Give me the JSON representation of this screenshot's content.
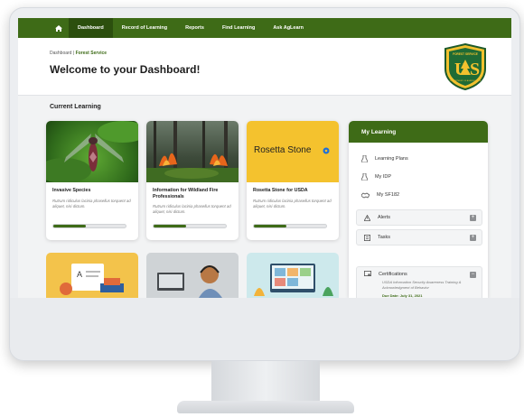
{
  "nav": {
    "home_icon": "home-icon",
    "items": [
      {
        "label": "Dashboard",
        "active": true
      },
      {
        "label": "Record of Learning"
      },
      {
        "label": "Reports"
      },
      {
        "label": "Find Learning"
      },
      {
        "label": "Ask AgLearn"
      }
    ]
  },
  "header": {
    "breadcrumb_root": "Dashboard",
    "breadcrumb_sep": "|",
    "breadcrumb_current": "Forest Service",
    "title": "Welcome to your Dashboard!"
  },
  "logo": {
    "top_text": "FOREST SERVICE",
    "letters": "US",
    "bottom_text": "DEPARTMENT OF AGRICULTURE"
  },
  "current_learning": {
    "title": "Current Learning",
    "cards": [
      {
        "title": "Invasive Species",
        "desc": "Rutrum ridiculus lacinia phasellus torquent ad aliquet, nisi dictum.",
        "progress": 0.45
      },
      {
        "title": "Information for Wildland Fire Professionals",
        "desc": "Rutrum ridiculus lacinia phasellus torquent ad aliquet, nisi dictum.",
        "progress": 0.45
      },
      {
        "title": "Rosetta Stone for USDA",
        "desc": "Rutrum ridiculus lacinia phasellus torquent ad aliquet, nisi dictum.",
        "progress": 0.45,
        "brand": "Rosetta Stone"
      }
    ]
  },
  "my_learning": {
    "title": "My Learning",
    "links": [
      {
        "label": "Learning Plans",
        "icon": "flask-icon"
      },
      {
        "label": "My IDP",
        "icon": "flask-icon"
      },
      {
        "label": "My SF182",
        "icon": "handshake-icon"
      }
    ],
    "accordions": [
      {
        "label": "Alerts",
        "icon": "warning-icon",
        "toggle": "+"
      },
      {
        "label": "Tasks",
        "icon": "list-icon",
        "toggle": "+"
      }
    ],
    "certifications": {
      "label": "Certifications",
      "icon": "certificate-icon",
      "toggle": "−",
      "desc": "USDA Information Security Awareness Training & Acknowledgment of Behavior",
      "due": "Due Date: July 31, 2021"
    }
  },
  "colors": {
    "brand_green": "#3e6b17",
    "nav_active": "#2c4f0e",
    "rosetta_yellow": "#f4c22e"
  }
}
